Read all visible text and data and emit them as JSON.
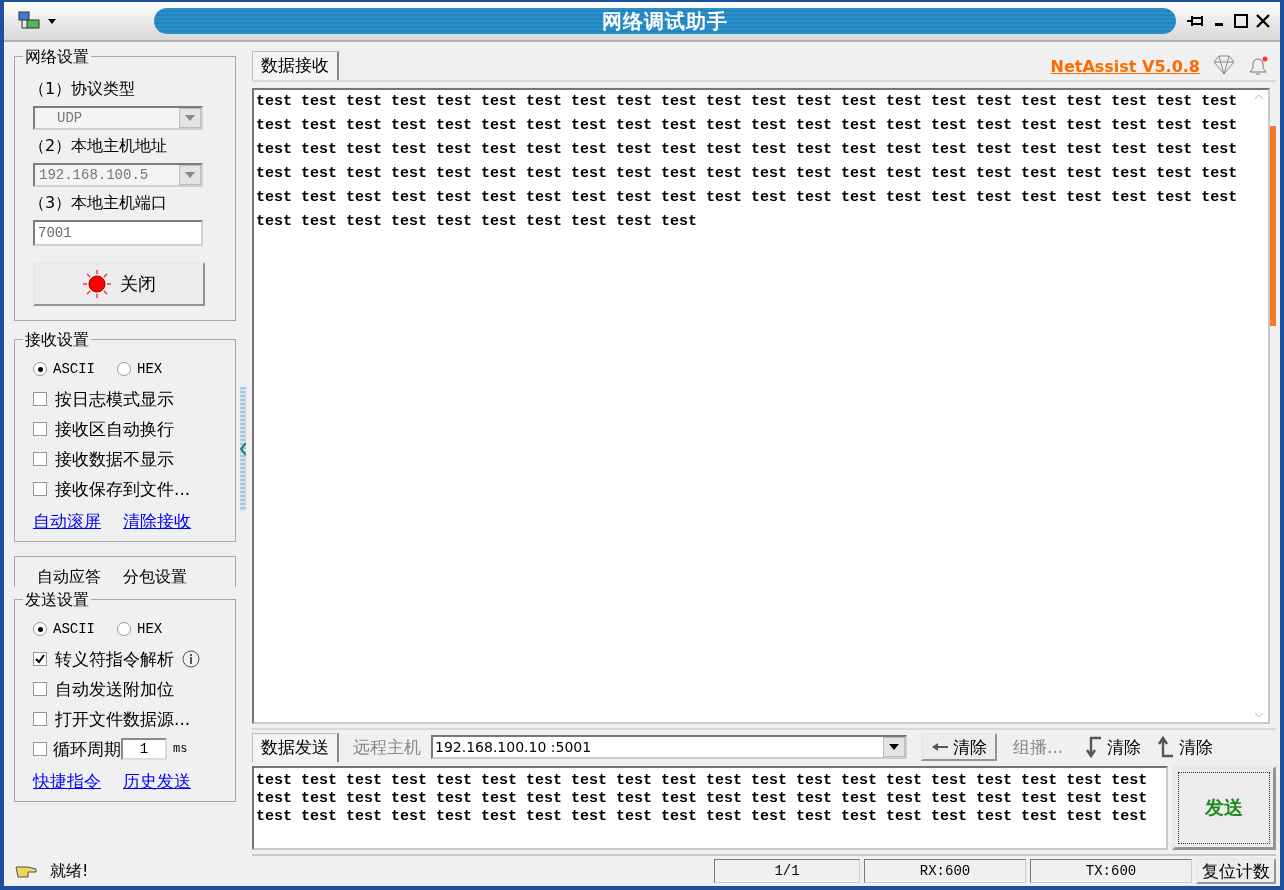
{
  "window": {
    "title": "网络调试助手"
  },
  "network_settings": {
    "title": "网络设置",
    "protocol": {
      "label": "（1）协议类型",
      "value": "UDP"
    },
    "host": {
      "label": "（2）本地主机地址",
      "value": "192.168.100.5"
    },
    "port": {
      "label": "（3）本地主机端口",
      "value": "7001"
    },
    "close_button": "关闭"
  },
  "receive_settings": {
    "title": "接收设置",
    "modes": [
      {
        "label": "ASCII",
        "selected": true
      },
      {
        "label": "HEX",
        "selected": false
      }
    ],
    "options": [
      {
        "label": "按日志模式显示",
        "checked": false
      },
      {
        "label": "接收区自动换行",
        "checked": false
      },
      {
        "label": "接收数据不显示",
        "checked": false
      },
      {
        "label": "接收保存到文件...",
        "checked": false
      }
    ],
    "links": [
      "自动滚屏",
      "清除接收"
    ]
  },
  "side_tabs": [
    "自动应答",
    "分包设置"
  ],
  "send_settings": {
    "title": "发送设置",
    "modes": [
      {
        "label": "ASCII",
        "selected": true
      },
      {
        "label": "HEX",
        "selected": false
      }
    ],
    "options": [
      {
        "label": "转义符指令解析",
        "checked": true,
        "kind": "info"
      },
      {
        "label": "自动发送附加位",
        "checked": false,
        "kind": "plain"
      },
      {
        "label": "打开文件数据源...",
        "checked": false,
        "kind": "plain"
      }
    ],
    "loop": {
      "label": "循环周期",
      "checked": false,
      "value": "1",
      "unit": "ms"
    },
    "links": [
      "快捷指令",
      "历史发送"
    ]
  },
  "receive": {
    "tab": "数据接收",
    "brand": "NetAssist V5.0.8",
    "lines": [
      "test test test test test test test test test test test test test test test test test test test test test test",
      "test test test test test test test test test test test test test test test test test test test test test test",
      "test test test test test test test test test test test test test test test test test test test test test test",
      "test test test test test test test test test test test test test test test test test test test test test test",
      "test test test test test test test test test test test test test test test test test test test test test test",
      "test test test test test test test test test test"
    ]
  },
  "send": {
    "tab": "数据发送",
    "remote_label": "远程主机",
    "remote_value": "192.168.100.10 :5001",
    "clear_button": "清除",
    "multicast": "组播...",
    "clear_rx": "清除",
    "clear_tx": "清除",
    "lines": [
      "test test test test test test test test test test test test test test test test test test test test",
      "test test test test test test test test test test test test test test test test test test test test",
      "test test test test test test test test test test test test test test test test test test test test"
    ],
    "send_button": "发送"
  },
  "status_bar": {
    "message": "就绪!",
    "page": "1/1",
    "rx": "RX:600",
    "tx": "TX:600",
    "reset_button": "复位计数"
  }
}
